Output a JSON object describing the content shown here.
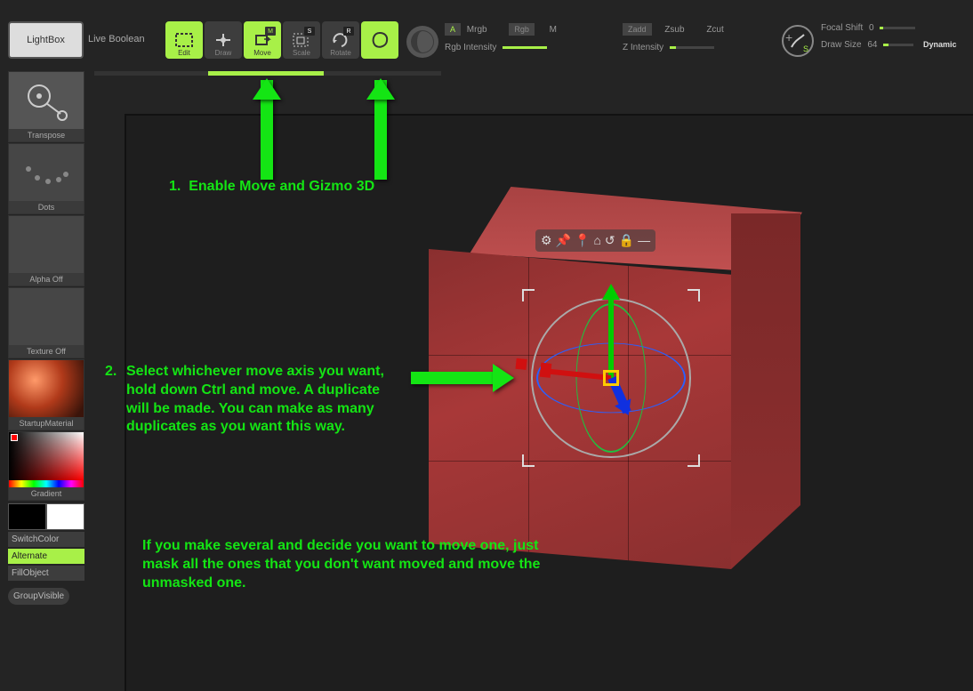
{
  "topbar": {
    "lightbox": "LightBox",
    "liveboolean": "Live Boolean",
    "tools": {
      "edit": "Edit",
      "draw": "Draw",
      "move": "Move",
      "move_badge": "M",
      "scale": "Scale",
      "scale_badge": "S",
      "rotate": "Rotate",
      "rotate_badge": "R"
    },
    "color_mode": {
      "a_chip": "A",
      "mrgb": "Mrgb",
      "rgb_chip": "Rgb",
      "m": "M",
      "rgb_intensity": "Rgb Intensity"
    },
    "z_mode": {
      "zadd": "Zadd",
      "zsub": "Zsub",
      "zcut": "Zcut",
      "z_intensity": "Z Intensity"
    },
    "brush": {
      "focal_shift": "Focal Shift",
      "focal_val": "0",
      "draw_size": "Draw Size",
      "draw_val": "64",
      "dynamic": "Dynamic",
      "s_badge": "S"
    }
  },
  "left": {
    "transpose": "Transpose",
    "dots": "Dots",
    "alpha_off": "Alpha Off",
    "texture_off": "Texture Off",
    "startup_material": "StartupMaterial",
    "gradient": "Gradient",
    "switchcolor": "SwitchColor",
    "alternate": "Alternate",
    "fillobject": "FillObject",
    "groupvisible": "GroupVisible"
  },
  "annotations": {
    "step1_num": "1.",
    "step1": "Enable Move and Gizmo 3D",
    "step2_num": "2.",
    "step2": "Select whichever move axis you want, hold down Ctrl and move. A duplicate will be made. You can make as many duplicates as you want this way.",
    "note": "If you make several and decide you want to move one, just mask all the ones that you don't want moved and move the unmasked one."
  },
  "gizmo_icons": [
    "gear",
    "pin",
    "marker",
    "home",
    "undo",
    "lock",
    "minus"
  ]
}
